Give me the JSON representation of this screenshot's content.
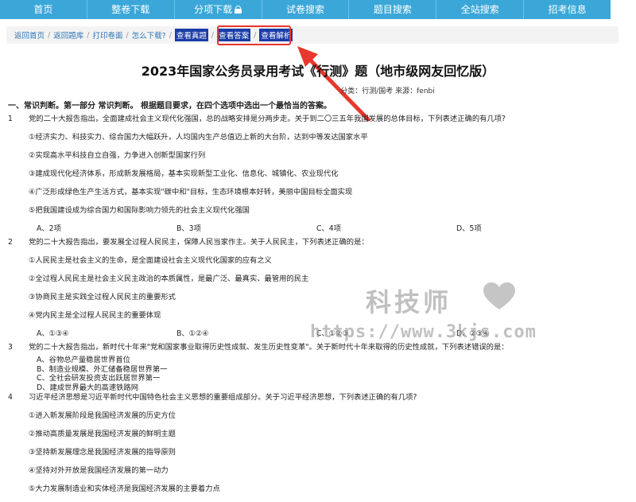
{
  "nav": [
    "首页",
    "整卷下载",
    "分项下载",
    "试卷搜索",
    "题目搜索",
    "全站搜索",
    "招考信息"
  ],
  "breadcrumb": [
    "返回首页",
    "返回题库",
    "打印卷面",
    "怎么下载?",
    "查看真题",
    "查看答案",
    "查看解析"
  ],
  "title": "2023年国家公务员录用考试《行测》题（地市级网友回忆版）",
  "meta": "分类：行测/国考    来源：fenbi",
  "section": "一、常识判断。第一部分 常识判断。 根据题目要求，在四个选项中选出一个最恰当的答案。",
  "questions": [
    {
      "num": "1",
      "text": "党的二十大报告指出，全面建成社会主义现代化强国，总的战略安排是分两步走。关于到二〇三五年我国发展的总体目标，下列表述正确的有几项?",
      "statements": [
        "①经济实力、科技实力、综合国力大幅跃升，人均国内生产总值迈上新的大台阶，达到中等发达国家水平",
        "②实现高水平科技自立自强，力争进入创新型国家行列",
        "③建成现代化经济体系，形成新发展格局，基本实现新型工业化、信息化、城镇化、农业现代化",
        "④广泛形成绿色生产生活方式，基本实现\"碳中和\"目标，生态环境根本好转，美丽中国目标全面实现",
        "⑤把我国建设成为综合国力和国际影响力领先的社会主义现代化强国"
      ],
      "options": [
        "A、2项",
        "B、3项",
        "C、4项",
        "D、5项"
      ]
    },
    {
      "num": "2",
      "text": "党的二十大报告指出，要发展全过程人民民主，保障人民当家作主。关于人民民主，下列表述正确的是：",
      "statements": [
        "①人民民主是社会主义的生命，是全面建设社会主义现代化国家的应有之义",
        "②全过程人民民主是社会主义民主政治的本质属性，是最广泛、最真实、最管用的民主",
        "③协商民主是实践全过程人民民主的重要形式",
        "④党内民主是全过程人民民主的重要体现"
      ],
      "options": [
        "A、①③④",
        "B、①②④",
        "C、①②③",
        "D、②③④"
      ]
    },
    {
      "num": "3",
      "text": "党的二十大报告指出，新时代十年来\"党和国家事业取得历史性成就、发生历史性变革\"。关于新时代十年来取得的历史性成就，下列表述错误的是：",
      "list": [
        "A、谷物总产量稳居世界首位",
        "B、制造业规模、外汇储备稳居世界第一",
        "C、全社会研发投资支出跃居世界第一",
        "D、建成世界最大的高速铁路网"
      ]
    },
    {
      "num": "4",
      "text": "习近平经济思想是习近平新时代中国特色社会主义思想的重要组成部分。关于习近平经济思想，下列表述正确的有几项?",
      "statements": [
        "①进入新发展阶段是我国经济发展的历史方位",
        "②推动高质量发展是我国经济发展的鲜明主题",
        "③坚持新发展理念是我国经济发展的指导原则",
        "④坚持对外开放是我国经济发展的第一动力",
        "⑤大力发展制造业和实体经济是我国经济发展的主要着力点"
      ]
    }
  ],
  "watermark": {
    "brand": "科技师",
    "url": "https://www.3kjs.com"
  },
  "colors": {
    "nav": "#3ba7d8",
    "highlight": "#e8372c",
    "link": "#2f74b5"
  }
}
